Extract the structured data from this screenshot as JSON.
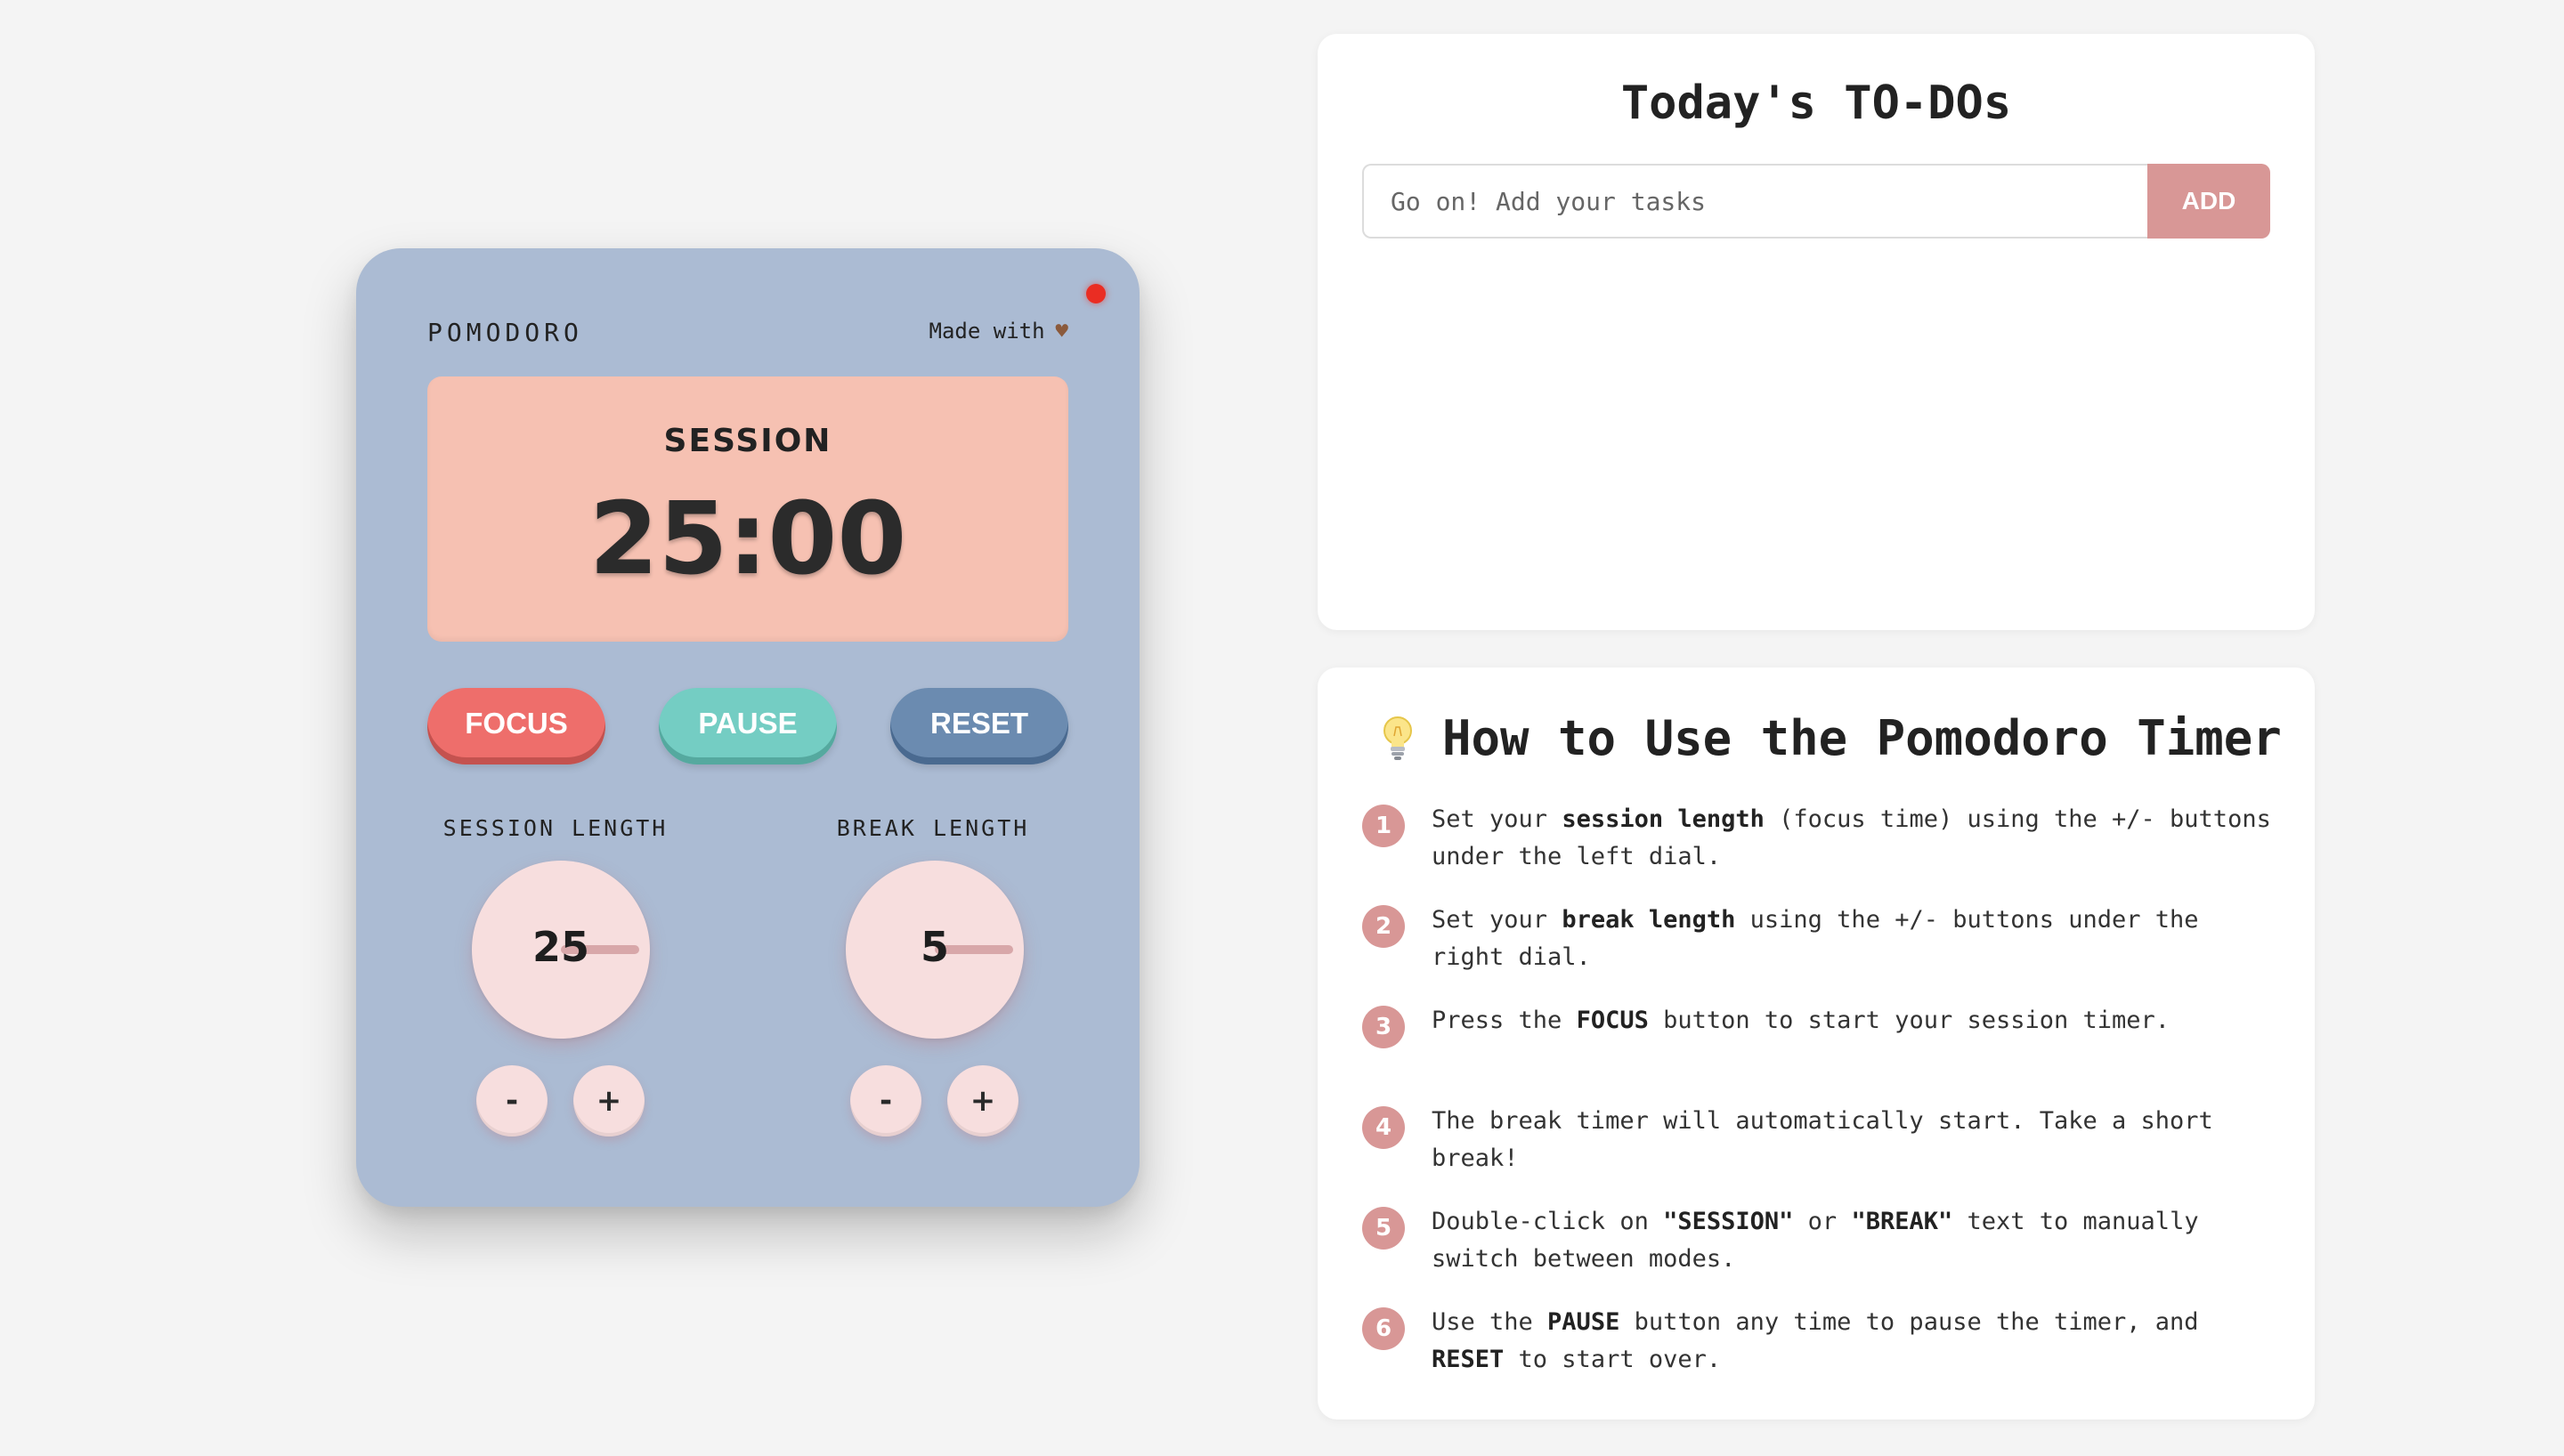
{
  "pomodoro": {
    "brand": "POMODORO",
    "made_with": "Made with",
    "heart_icon": "heart-icon",
    "indicator_color": "#ea2d23",
    "mode": "SESSION",
    "time": "25:00",
    "buttons": {
      "focus": "FOCUS",
      "pause": "PAUSE",
      "reset": "RESET"
    },
    "session": {
      "label": "SESSION LENGTH",
      "value": "25",
      "minus": "-",
      "plus": "+"
    },
    "break": {
      "label": "BREAK LENGTH",
      "value": "5",
      "minus": "-",
      "plus": "+"
    }
  },
  "todo": {
    "title": "Today's TO-DOs",
    "placeholder": "Go on! Add your tasks",
    "value": "",
    "add_label": "ADD"
  },
  "help": {
    "title": "How to Use the Pomodoro Timer",
    "icon": "lightbulb-icon",
    "steps": [
      {
        "num": "1",
        "parts": [
          {
            "t": "Set your "
          },
          {
            "t": "session length",
            "b": true
          },
          {
            "t": " (focus time) using the +/- buttons under the left dial."
          }
        ]
      },
      {
        "num": "2",
        "parts": [
          {
            "t": "Set your "
          },
          {
            "t": "break length",
            "b": true
          },
          {
            "t": " using the +/- buttons under the right dial."
          }
        ]
      },
      {
        "num": "3",
        "parts": [
          {
            "t": "Press the "
          },
          {
            "t": "FOCUS",
            "b": true
          },
          {
            "t": " button to start your session timer."
          }
        ]
      },
      {
        "num": "4",
        "parts": [
          {
            "t": "The break timer will automatically start. Take a short break!"
          }
        ]
      },
      {
        "num": "5",
        "parts": [
          {
            "t": "Double-click on "
          },
          {
            "t": "\"SESSION\"",
            "b": true
          },
          {
            "t": " or "
          },
          {
            "t": "\"BREAK\"",
            "b": true
          },
          {
            "t": " text to manually switch between modes."
          }
        ]
      },
      {
        "num": "6",
        "parts": [
          {
            "t": "Use the "
          },
          {
            "t": "PAUSE",
            "b": true
          },
          {
            "t": " button any time to pause the timer, and "
          },
          {
            "t": "RESET",
            "b": true
          },
          {
            "t": " to start over."
          }
        ]
      }
    ]
  },
  "colors": {
    "background": "#f4f4f4",
    "device": "#abbbd3",
    "screen": "#f6c1b2",
    "focus": "#ee6e6b",
    "pause": "#74cdc3",
    "reset": "#6b8bb0",
    "dial": "#f7dede",
    "accent": "#d89796"
  }
}
